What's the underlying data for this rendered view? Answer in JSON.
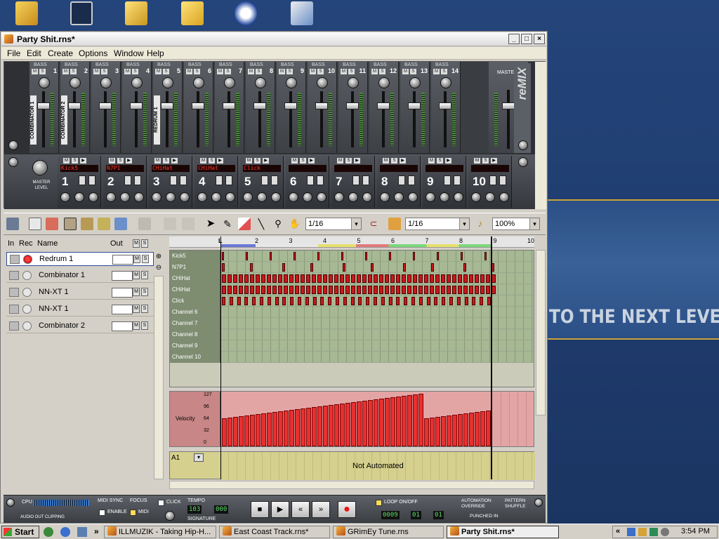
{
  "window": {
    "title": "Party Shit.rns*"
  },
  "menu": [
    "File",
    "Edit",
    "Create",
    "Options",
    "Window",
    "Help"
  ],
  "banner": {
    "text": "TO THE NEXT LEVEL"
  },
  "mixer": {
    "channels": [
      {
        "num": "1",
        "name": "COMBINATOR 1"
      },
      {
        "num": "2",
        "name": "COMBINATOR 2"
      },
      {
        "num": "3",
        "name": ""
      },
      {
        "num": "4",
        "name": ""
      },
      {
        "num": "5",
        "name": "REDRUM 1"
      },
      {
        "num": "6",
        "name": ""
      },
      {
        "num": "7",
        "name": ""
      },
      {
        "num": "8",
        "name": ""
      },
      {
        "num": "9",
        "name": ""
      },
      {
        "num": "10",
        "name": ""
      },
      {
        "num": "11",
        "name": ""
      },
      {
        "num": "12",
        "name": ""
      },
      {
        "num": "13",
        "name": ""
      },
      {
        "num": "14",
        "name": ""
      }
    ],
    "bass_label": "BASS",
    "master_label": "MASTER",
    "brand": "reMIX"
  },
  "redrum": {
    "master_level_label": "MASTER LEVEL",
    "channels": [
      {
        "num": "1",
        "disp": "Kick5"
      },
      {
        "num": "2",
        "disp": "N7P1"
      },
      {
        "num": "3",
        "disp": "CHiHat"
      },
      {
        "num": "4",
        "disp": "CHiHat"
      },
      {
        "num": "5",
        "disp": "Click"
      },
      {
        "num": "6",
        "disp": ""
      },
      {
        "num": "7",
        "disp": ""
      },
      {
        "num": "8",
        "disp": ""
      },
      {
        "num": "9",
        "disp": ""
      },
      {
        "num": "10",
        "disp": ""
      }
    ]
  },
  "toolbar": {
    "quantize1": "1/16",
    "quantize2": "1/16",
    "zoom": "100%"
  },
  "tracklist": {
    "headers": {
      "in": "In",
      "rec": "Rec",
      "name": "Name",
      "out": "Out"
    },
    "tracks": [
      {
        "name": "Redrum 1",
        "selected": true
      },
      {
        "name": "Combinator 1",
        "selected": false
      },
      {
        "name": "NN-XT 1",
        "selected": false
      },
      {
        "name": "NN-XT 1",
        "selected": false
      },
      {
        "name": "Combinator 2",
        "selected": false
      }
    ]
  },
  "sequencer": {
    "ruler": [
      "2",
      "3",
      "4",
      "5",
      "6",
      "7",
      "8",
      "9",
      "10"
    ],
    "lanes": [
      "Kick5",
      "N7P1",
      "CHiHat",
      "CHiHat",
      "Click",
      "Channel 6",
      "Channel 7",
      "Channel 8",
      "Channel 9",
      "Channel 10"
    ],
    "velocity_label": "Velocity",
    "velocity_ticks": [
      "127",
      "96",
      "64",
      "32",
      "0"
    ],
    "automation_selector": "A1",
    "automation_text": "Not Automated"
  },
  "transport": {
    "cpu_label": "CPU",
    "clip_label": "AUDIO OUT CLIPPING",
    "midi_sync_label": "MIDI SYNC",
    "focus_label": "FOCUS",
    "enable_label": "ENABLE",
    "midi_label": "MIDI",
    "click_label": "CLICK",
    "tempo_label": "TEMPO",
    "tempo_value": "103",
    "tempo_frac": "000",
    "signature_label": "SIGNATURE",
    "loop_label": "LOOP ON/OFF",
    "automation_override_label": "AUTOMATION OVERRIDE",
    "punched_in_label": "PUNCHED IN",
    "pattern_shuffle_label": "PATTERN SHUFFLE",
    "loop_left": "0009",
    "loop_mid": "01",
    "loop_right": "01"
  },
  "taskbar": {
    "start": "Start",
    "tasks": [
      {
        "label": "ILLMUZIK - Taking Hip-H...",
        "active": false
      },
      {
        "label": "East Coast Track.rns*",
        "active": false
      },
      {
        "label": "GRimEy Tune.rns",
        "active": false
      },
      {
        "label": "Party Shit.rns*",
        "active": true
      }
    ],
    "clock": "3:54 PM"
  },
  "colors": {
    "note": "#c9181d",
    "grid": "#a7b894",
    "velocity": "#e83030",
    "automation": "#d6d08e"
  }
}
